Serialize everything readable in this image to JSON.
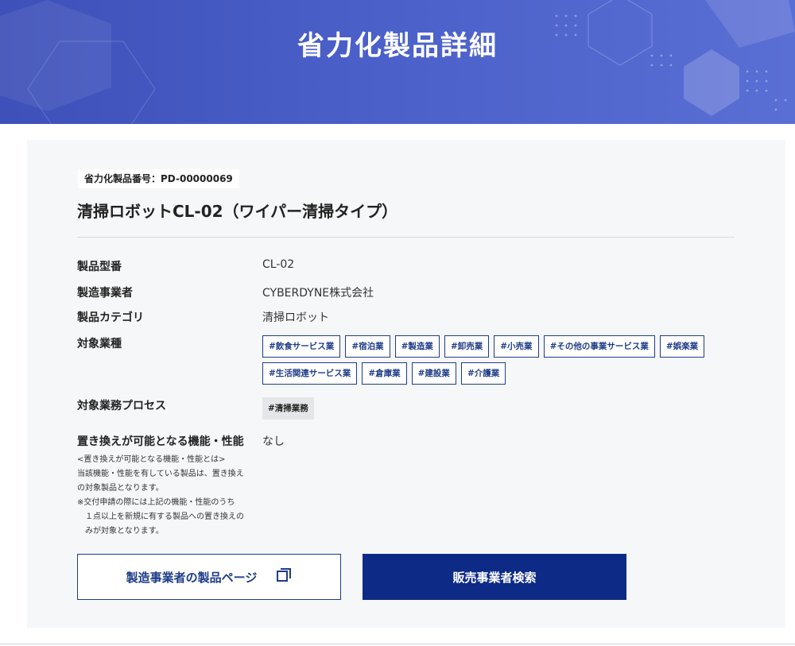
{
  "header": {
    "title": "省力化製品詳細"
  },
  "product": {
    "number_label": "省力化製品番号：",
    "number": "PD-00000069",
    "title": "清掃ロボットCL-02（ワイパー清掃タイプ）"
  },
  "fields": {
    "model": {
      "label": "製品型番",
      "value": "CL-02"
    },
    "maker": {
      "label": "製造事業者",
      "value": "CYBERDYNE株式会社"
    },
    "category": {
      "label": "製品カテゴリ",
      "value": "清掃ロボット"
    },
    "industries": {
      "label": "対象業種",
      "tags": [
        "#飲食サービス業",
        "#宿泊業",
        "#製造業",
        "#卸売業",
        "#小売業",
        "#その他の事業サービス業",
        "#娯楽業",
        "#生活関連サービス業",
        "#倉庫業",
        "#建設業",
        "#介護業"
      ]
    },
    "process": {
      "label": "対象業務プロセス",
      "tag": "#清掃業務"
    },
    "replace": {
      "label": "置き換えが可能となる機能・性能",
      "value": "なし",
      "note_title": "<置き換えが可能となる機能・性能とは>",
      "note_line1": "当該機能・性能を有している製品は、置き換えの対象製品となります。",
      "note_line2": "※交付申請の際には上記の機能・性能のうち",
      "note_line3": "１点以上を新規に有する製品への置き換えのみが対象となります。"
    }
  },
  "buttons": {
    "maker_page": "製造事業者の製品ページ",
    "maker_page_icon": "external-window-icon",
    "dealer_search": "販売事業者検索"
  },
  "colors": {
    "hero": "#4a5fc8",
    "primary": "#0d2b86",
    "tag_border": "#1f3c88"
  }
}
